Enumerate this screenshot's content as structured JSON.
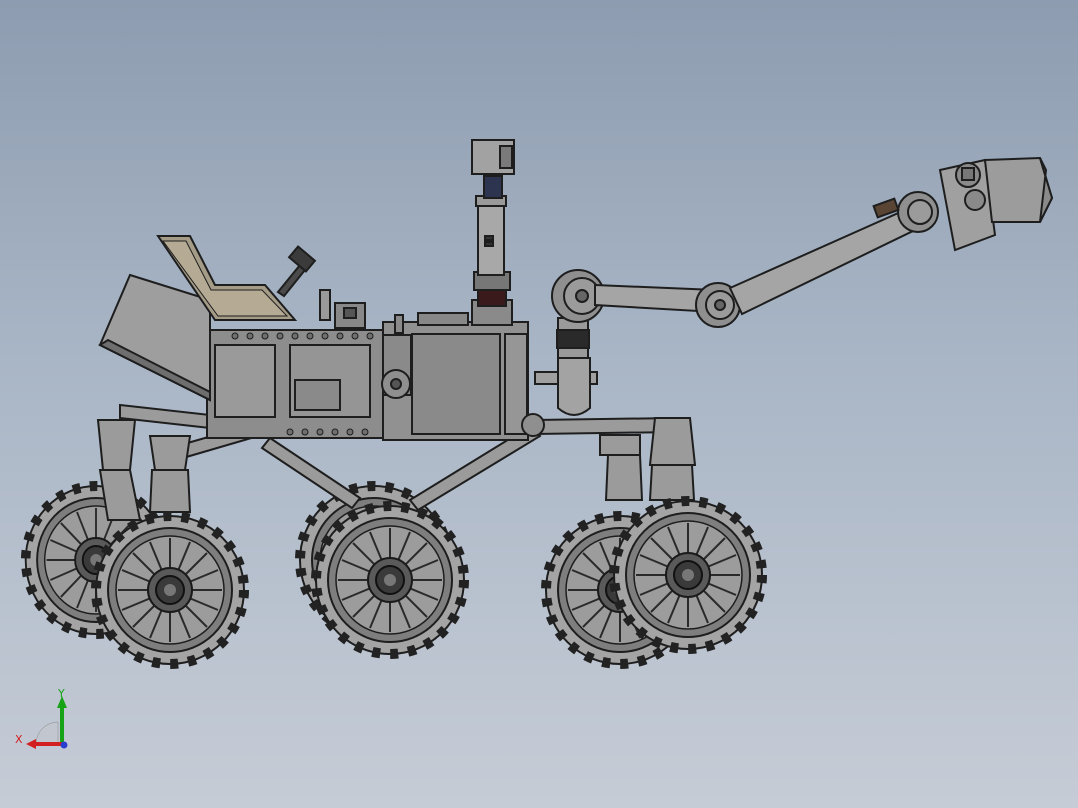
{
  "viewport": {
    "background_top": "#8d9cb0",
    "background_bottom": "#c6ccd6"
  },
  "model": {
    "subject": "rover",
    "part_color": "#8c8c8c",
    "edge_color": "#1e1e1e"
  },
  "triad": {
    "x_label": "X",
    "y_label": "Y",
    "x_color": "#d22020",
    "y_color": "#16a316",
    "z_color": "#2a3fd0"
  }
}
